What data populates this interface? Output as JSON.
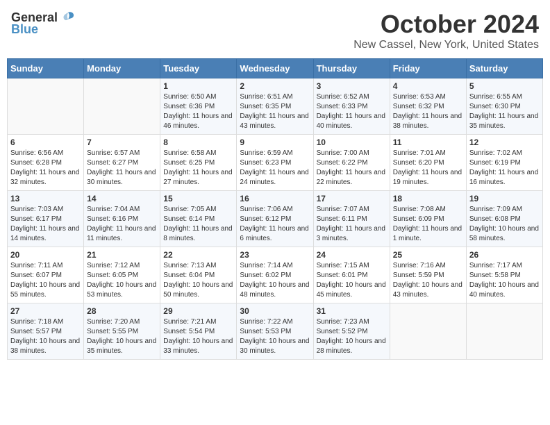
{
  "header": {
    "logo_general": "General",
    "logo_blue": "Blue",
    "month_title": "October 2024",
    "location": "New Cassel, New York, United States"
  },
  "weekdays": [
    "Sunday",
    "Monday",
    "Tuesday",
    "Wednesday",
    "Thursday",
    "Friday",
    "Saturday"
  ],
  "weeks": [
    [
      {
        "day": "",
        "info": ""
      },
      {
        "day": "",
        "info": ""
      },
      {
        "day": "1",
        "info": "Sunrise: 6:50 AM\nSunset: 6:36 PM\nDaylight: 11 hours and 46 minutes."
      },
      {
        "day": "2",
        "info": "Sunrise: 6:51 AM\nSunset: 6:35 PM\nDaylight: 11 hours and 43 minutes."
      },
      {
        "day": "3",
        "info": "Sunrise: 6:52 AM\nSunset: 6:33 PM\nDaylight: 11 hours and 40 minutes."
      },
      {
        "day": "4",
        "info": "Sunrise: 6:53 AM\nSunset: 6:32 PM\nDaylight: 11 hours and 38 minutes."
      },
      {
        "day": "5",
        "info": "Sunrise: 6:55 AM\nSunset: 6:30 PM\nDaylight: 11 hours and 35 minutes."
      }
    ],
    [
      {
        "day": "6",
        "info": "Sunrise: 6:56 AM\nSunset: 6:28 PM\nDaylight: 11 hours and 32 minutes."
      },
      {
        "day": "7",
        "info": "Sunrise: 6:57 AM\nSunset: 6:27 PM\nDaylight: 11 hours and 30 minutes."
      },
      {
        "day": "8",
        "info": "Sunrise: 6:58 AM\nSunset: 6:25 PM\nDaylight: 11 hours and 27 minutes."
      },
      {
        "day": "9",
        "info": "Sunrise: 6:59 AM\nSunset: 6:23 PM\nDaylight: 11 hours and 24 minutes."
      },
      {
        "day": "10",
        "info": "Sunrise: 7:00 AM\nSunset: 6:22 PM\nDaylight: 11 hours and 22 minutes."
      },
      {
        "day": "11",
        "info": "Sunrise: 7:01 AM\nSunset: 6:20 PM\nDaylight: 11 hours and 19 minutes."
      },
      {
        "day": "12",
        "info": "Sunrise: 7:02 AM\nSunset: 6:19 PM\nDaylight: 11 hours and 16 minutes."
      }
    ],
    [
      {
        "day": "13",
        "info": "Sunrise: 7:03 AM\nSunset: 6:17 PM\nDaylight: 11 hours and 14 minutes."
      },
      {
        "day": "14",
        "info": "Sunrise: 7:04 AM\nSunset: 6:16 PM\nDaylight: 11 hours and 11 minutes."
      },
      {
        "day": "15",
        "info": "Sunrise: 7:05 AM\nSunset: 6:14 PM\nDaylight: 11 hours and 8 minutes."
      },
      {
        "day": "16",
        "info": "Sunrise: 7:06 AM\nSunset: 6:12 PM\nDaylight: 11 hours and 6 minutes."
      },
      {
        "day": "17",
        "info": "Sunrise: 7:07 AM\nSunset: 6:11 PM\nDaylight: 11 hours and 3 minutes."
      },
      {
        "day": "18",
        "info": "Sunrise: 7:08 AM\nSunset: 6:09 PM\nDaylight: 11 hours and 1 minute."
      },
      {
        "day": "19",
        "info": "Sunrise: 7:09 AM\nSunset: 6:08 PM\nDaylight: 10 hours and 58 minutes."
      }
    ],
    [
      {
        "day": "20",
        "info": "Sunrise: 7:11 AM\nSunset: 6:07 PM\nDaylight: 10 hours and 55 minutes."
      },
      {
        "day": "21",
        "info": "Sunrise: 7:12 AM\nSunset: 6:05 PM\nDaylight: 10 hours and 53 minutes."
      },
      {
        "day": "22",
        "info": "Sunrise: 7:13 AM\nSunset: 6:04 PM\nDaylight: 10 hours and 50 minutes."
      },
      {
        "day": "23",
        "info": "Sunrise: 7:14 AM\nSunset: 6:02 PM\nDaylight: 10 hours and 48 minutes."
      },
      {
        "day": "24",
        "info": "Sunrise: 7:15 AM\nSunset: 6:01 PM\nDaylight: 10 hours and 45 minutes."
      },
      {
        "day": "25",
        "info": "Sunrise: 7:16 AM\nSunset: 5:59 PM\nDaylight: 10 hours and 43 minutes."
      },
      {
        "day": "26",
        "info": "Sunrise: 7:17 AM\nSunset: 5:58 PM\nDaylight: 10 hours and 40 minutes."
      }
    ],
    [
      {
        "day": "27",
        "info": "Sunrise: 7:18 AM\nSunset: 5:57 PM\nDaylight: 10 hours and 38 minutes."
      },
      {
        "day": "28",
        "info": "Sunrise: 7:20 AM\nSunset: 5:55 PM\nDaylight: 10 hours and 35 minutes."
      },
      {
        "day": "29",
        "info": "Sunrise: 7:21 AM\nSunset: 5:54 PM\nDaylight: 10 hours and 33 minutes."
      },
      {
        "day": "30",
        "info": "Sunrise: 7:22 AM\nSunset: 5:53 PM\nDaylight: 10 hours and 30 minutes."
      },
      {
        "day": "31",
        "info": "Sunrise: 7:23 AM\nSunset: 5:52 PM\nDaylight: 10 hours and 28 minutes."
      },
      {
        "day": "",
        "info": ""
      },
      {
        "day": "",
        "info": ""
      }
    ]
  ]
}
